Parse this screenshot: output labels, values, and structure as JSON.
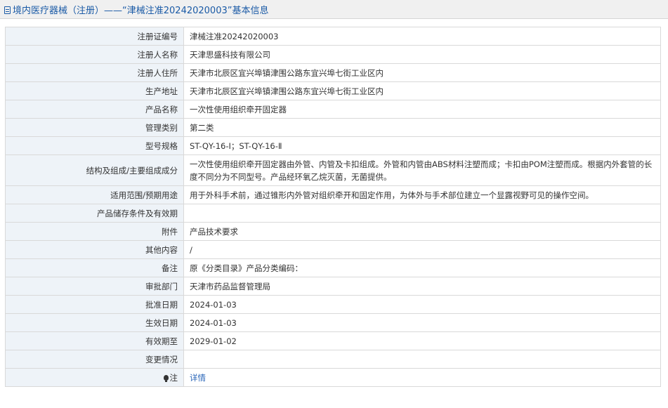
{
  "title": {
    "prefix": "境内医疗器械（注册）",
    "separator": "——",
    "quoted": "“津械注准20242020003”",
    "suffix": "基本信息"
  },
  "rows": [
    {
      "label": "注册证编号",
      "value": "津械注准20242020003"
    },
    {
      "label": "注册人名称",
      "value": "天津思盛科技有限公司"
    },
    {
      "label": "注册人住所",
      "value": "天津市北辰区宜兴埠镇津围公路东宜兴埠七街工业区内"
    },
    {
      "label": "生产地址",
      "value": "天津市北辰区宜兴埠镇津围公路东宜兴埠七街工业区内"
    },
    {
      "label": "产品名称",
      "value": "一次性使用组织牵开固定器"
    },
    {
      "label": "管理类别",
      "value": "第二类"
    },
    {
      "label": "型号规格",
      "value": "ST-QY-16-Ⅰ；ST-QY-16-Ⅱ"
    },
    {
      "label": "结构及组成/主要组成成分",
      "value": "一次性使用组织牵开固定器由外管、内管及卡扣组成。外管和内管由ABS材料注塑而成；卡扣由POM注塑而成。根据内外套管的长度不同分为不同型号。产品经环氧乙烷灭菌，无菌提供。"
    },
    {
      "label": "适用范围/预期用途",
      "value": "用于外科手术前，通过锥形内外管对组织牵开和固定作用，为体外与手术部位建立一个显露视野可见的操作空间。"
    },
    {
      "label": "产品储存条件及有效期",
      "value": ""
    },
    {
      "label": "附件",
      "value": "产品技术要求"
    },
    {
      "label": "其他内容",
      "value": "/"
    },
    {
      "label": "备注",
      "value": "原《分类目录》产品分类编码："
    },
    {
      "label": "审批部门",
      "value": "天津市药品监督管理局"
    },
    {
      "label": "批准日期",
      "value": "2024-01-03"
    },
    {
      "label": "生效日期",
      "value": "2024-01-03"
    },
    {
      "label": "有效期至",
      "value": "2029-01-02"
    },
    {
      "label": "变更情况",
      "value": ""
    }
  ],
  "note_row": {
    "label": "注",
    "icon": "bulb-icon",
    "link": "详情"
  },
  "colors": {
    "title_text": "#1a5aa6",
    "label_bg": "#eef3f8",
    "border": "#d9d9d9",
    "link": "#2a66b8"
  }
}
